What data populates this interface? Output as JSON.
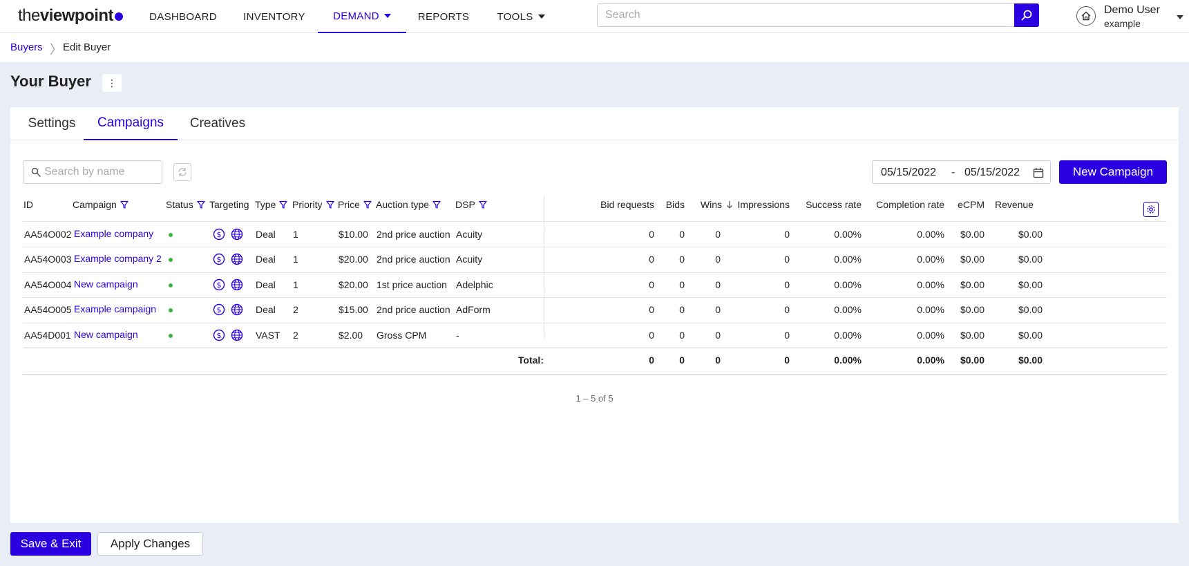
{
  "brand": {
    "logo_light": "the",
    "logo_bold": "viewpoint"
  },
  "nav": [
    {
      "label": "DASHBOARD",
      "active": false,
      "dropdown": false
    },
    {
      "label": "INVENTORY",
      "active": false,
      "dropdown": false
    },
    {
      "label": "DEMAND",
      "active": true,
      "dropdown": true
    },
    {
      "label": "REPORTS",
      "active": false,
      "dropdown": false
    },
    {
      "label": "TOOLS",
      "active": false,
      "dropdown": true
    }
  ],
  "search": {
    "placeholder": "Search",
    "icon": "search-icon"
  },
  "user": {
    "name": "Demo User",
    "account": "example",
    "icon": "home-icon"
  },
  "breadcrumb": {
    "parent": "Buyers",
    "current": "Edit Buyer"
  },
  "page": {
    "title": "Your Buyer",
    "menu_glyph": "⋮"
  },
  "tabs": [
    {
      "label": "Settings",
      "active": false
    },
    {
      "label": "Campaigns",
      "active": true
    },
    {
      "label": "Creatives",
      "active": false
    }
  ],
  "table_search": {
    "placeholder": "Search by name"
  },
  "date_range": {
    "from": "05/15/2022",
    "separator": "-",
    "to": "05/15/2022"
  },
  "new_campaign_label": "New Campaign",
  "columns": [
    "ID",
    "Campaign",
    "Status",
    "Targeting",
    "Type",
    "Priority",
    "Price",
    "Auction type",
    "DSP",
    "Bid requests",
    "Bids",
    "Wins",
    "Impressions",
    "Success rate",
    "Completion rate",
    "eCPM",
    "Revenue"
  ],
  "rows": [
    {
      "id": "AA54O002",
      "campaign": "Example company",
      "status": "active",
      "type": "Deal",
      "priority": "1",
      "price": "$10.00",
      "auction": "2nd price auction",
      "dsp": "Acuity",
      "bid_requests": "0",
      "bids": "0",
      "wins": "0",
      "impressions": "0",
      "success_rate": "0.00%",
      "completion_rate": "0.00%",
      "ecpm": "$0.00",
      "revenue": "$0.00"
    },
    {
      "id": "AA54O003",
      "campaign": "Example company 2",
      "status": "active",
      "type": "Deal",
      "priority": "1",
      "price": "$20.00",
      "auction": "2nd price auction",
      "dsp": "Acuity",
      "bid_requests": "0",
      "bids": "0",
      "wins": "0",
      "impressions": "0",
      "success_rate": "0.00%",
      "completion_rate": "0.00%",
      "ecpm": "$0.00",
      "revenue": "$0.00"
    },
    {
      "id": "AA54O004",
      "campaign": "New campaign",
      "status": "active",
      "type": "Deal",
      "priority": "1",
      "price": "$20.00",
      "auction": "1st price auction",
      "dsp": "Adelphic",
      "bid_requests": "0",
      "bids": "0",
      "wins": "0",
      "impressions": "0",
      "success_rate": "0.00%",
      "completion_rate": "0.00%",
      "ecpm": "$0.00",
      "revenue": "$0.00"
    },
    {
      "id": "AA54O005",
      "campaign": "Example campaign",
      "status": "active",
      "type": "Deal",
      "priority": "2",
      "price": "$15.00",
      "auction": "2nd price auction",
      "dsp": "AdForm",
      "bid_requests": "0",
      "bids": "0",
      "wins": "0",
      "impressions": "0",
      "success_rate": "0.00%",
      "completion_rate": "0.00%",
      "ecpm": "$0.00",
      "revenue": "$0.00"
    },
    {
      "id": "AA54D001",
      "campaign": "New campaign",
      "status": "active",
      "type": "VAST",
      "priority": "2",
      "price": "$2.00",
      "auction": "Gross CPM",
      "dsp": "-",
      "bid_requests": "0",
      "bids": "0",
      "wins": "0",
      "impressions": "0",
      "success_rate": "0.00%",
      "completion_rate": "0.00%",
      "ecpm": "$0.00",
      "revenue": "$0.00"
    }
  ],
  "totals": {
    "label": "Total:",
    "bid_requests": "0",
    "bids": "0",
    "wins": "0",
    "impressions": "0",
    "success_rate": "0.00%",
    "completion_rate": "0.00%",
    "ecpm": "$0.00",
    "revenue": "$0.00"
  },
  "pagination": "1 – 5 of 5",
  "footer": {
    "save_exit": "Save & Exit",
    "apply": "Apply Changes"
  },
  "colors": {
    "accent": "#2a00e0",
    "status_active": "#3cb543",
    "background": "#e9edf5"
  }
}
